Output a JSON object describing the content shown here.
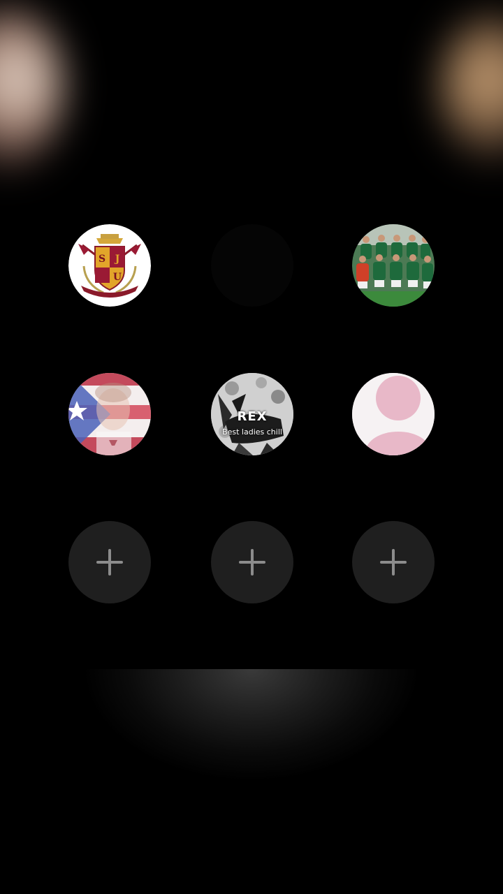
{
  "background_color": "#000000",
  "avatars": [
    {
      "name": "crest-logo",
      "kind": "image",
      "description_icon": "crest-emblem"
    },
    {
      "name": "empty-ghost",
      "kind": "placeholder"
    },
    {
      "name": "team-photo",
      "kind": "image",
      "description_icon": "team-photo"
    },
    {
      "name": "flag-portrait",
      "kind": "image",
      "description_icon": "flag-portrait"
    },
    {
      "name": "rex-logo",
      "kind": "image",
      "title": "REX",
      "subtitle": "Best ladies chill"
    },
    {
      "name": "default-profile",
      "kind": "image",
      "description_icon": "default-person-icon"
    }
  ],
  "add_buttons": [
    {
      "icon": "plus-icon"
    },
    {
      "icon": "plus-icon"
    },
    {
      "icon": "plus-icon"
    }
  ],
  "colors": {
    "add_button_bg": "#1f1f1f",
    "plus": "#8c8c8c",
    "default_profile_pink": "#e8b8c8"
  }
}
